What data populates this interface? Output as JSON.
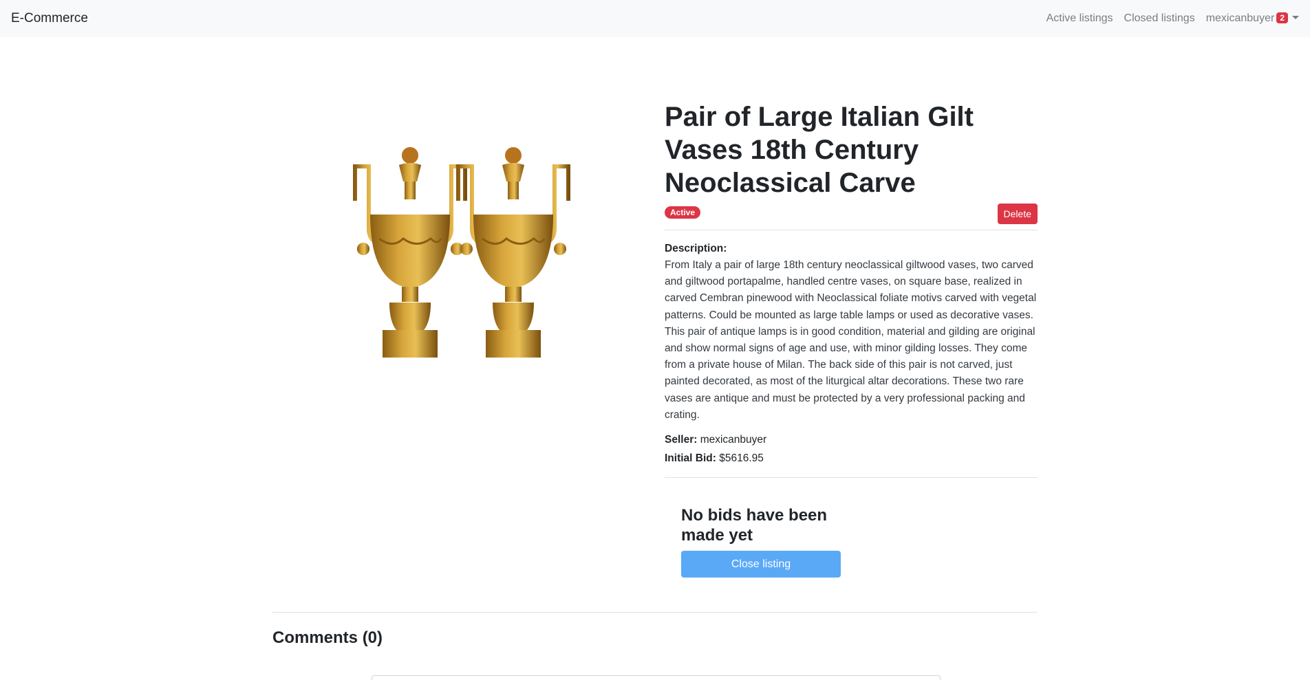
{
  "navbar": {
    "brand": "E-Commerce",
    "links": {
      "active": "Active listings",
      "closed": "Closed listings"
    },
    "user": {
      "name": "mexicanbuyer",
      "notification_count": "2"
    }
  },
  "listing": {
    "title": "Pair of Large Italian Gilt Vases 18th Century Neoclassical Carve",
    "status": "Active",
    "delete_label": "Delete",
    "description_label": "Description:",
    "description": "From Italy a pair of large 18th century neoclassical giltwood vases, two carved and giltwood portapalme, handled centre vases, on square base, realized in carved Cembran pinewood with Neoclassical foliate motivs carved with vegetal patterns. Could be mounted as large table lamps or used as decorative vases. This pair of antique lamps is in good condition, material and gilding are original and show normal signs of age and use, with minor gilding losses. They come from a private house of Milan. The back side of this pair is not carved, just painted decorated, as most of the liturgical altar decorations. These two rare vases are antique and must be protected by a very professional packing and crating.",
    "seller_label": "Seller:",
    "seller": "mexicanbuyer",
    "initial_bid_label": "Initial Bid:",
    "initial_bid": "$5616.95",
    "image_icon": "gilt-vases-image"
  },
  "bids": {
    "message": "No bids have been made yet",
    "close_label": "Close listing"
  },
  "comments": {
    "title": "Comments (0)"
  },
  "colors": {
    "danger": "#dc3545",
    "primary_light": "#5aa9f7",
    "navbar_bg": "#f8f9fa"
  }
}
